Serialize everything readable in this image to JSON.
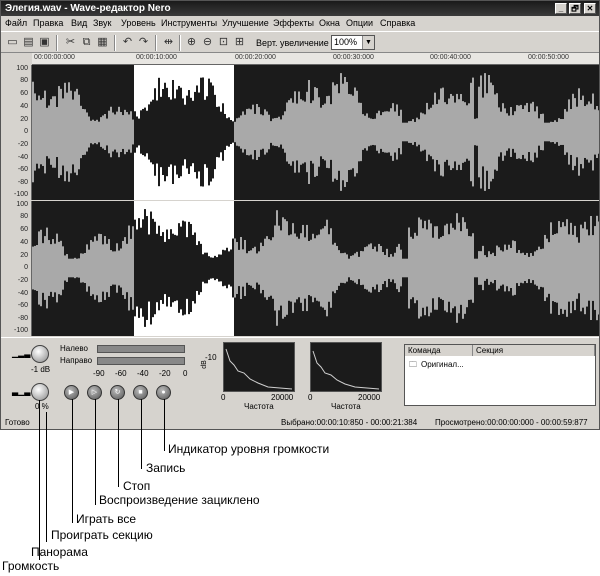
{
  "window": {
    "title": "Элегия.wav - Wave-редактор Nero",
    "minimize": "_",
    "maximize": "🗗",
    "close": "✕"
  },
  "menu": [
    "Файл",
    "Правка",
    "Вид",
    "Звук",
    "Уровень",
    "Инструменты",
    "Улучшение",
    "Эффекты",
    "Окна",
    "Опции",
    "Справка"
  ],
  "toolbar": {
    "zoom_label": "Верт. увеличение",
    "zoom_value": "100%"
  },
  "ruler": [
    "00:00:00:000",
    "00:00:10:000",
    "00:00:20:000",
    "00:00:30:000",
    "00:00:40:000",
    "00:00:50:000"
  ],
  "y_axis": [
    "100",
    "80",
    "60",
    "40",
    "20",
    "0",
    "-20",
    "-40",
    "-60",
    "-80",
    "-100"
  ],
  "meters": {
    "left_label": "Налево",
    "right_label": "Направо",
    "scale": [
      "-90",
      "-60",
      "-40",
      "-20",
      "0"
    ],
    "volume_value": "-1 dB",
    "pan_value": "0 %"
  },
  "spectrum": {
    "y_label": "dB",
    "y_tick": "-10",
    "x_ticks": [
      "0",
      "20000"
    ],
    "x_label": "Частота"
  },
  "history": {
    "col_command": "Команда",
    "col_section": "Секция",
    "item": "Оригинал..."
  },
  "status": {
    "ready": "Готово",
    "selected": "Выбрано:00:00:10:850 - 00:00:21:384",
    "viewed": "Просмотрено:00:00:00:000 - 00:00:59:877"
  },
  "callouts": {
    "level": "Индикатор уровня громкости",
    "record": "Запись",
    "stop": "Стоп",
    "loop": "Воспроизведение зациклено",
    "play_all": "Играть все",
    "play_section": "Проиграть секцию",
    "pan": "Панорама",
    "volume": "Громкость"
  }
}
